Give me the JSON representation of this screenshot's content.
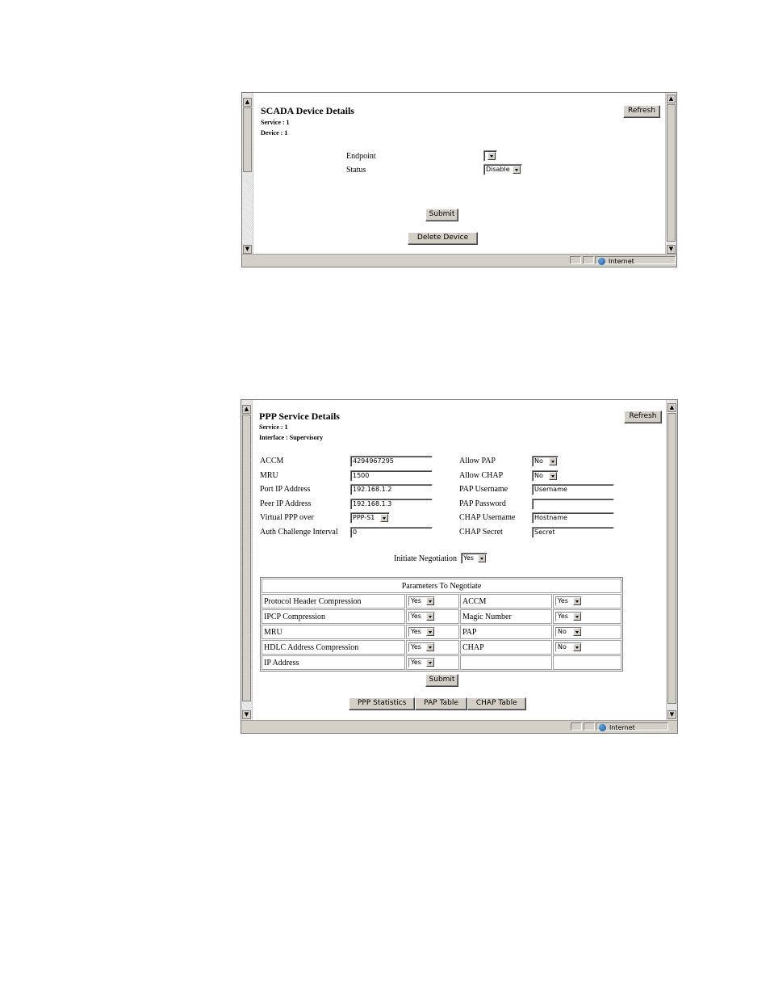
{
  "scada": {
    "title": "SCADA Device Details",
    "service": "Service : 1",
    "device": "Device : 1",
    "refresh_label": "Refresh",
    "endpoint_label": "Endpoint",
    "endpoint_value": "",
    "status_label": "Status",
    "status_value": "Disable",
    "submit_label": "Submit",
    "delete_label": "Delete Device",
    "zone_label": "Internet"
  },
  "ppp": {
    "title": "PPP Service Details",
    "service": "Service : 1",
    "interface": "Interface : Supervisory",
    "refresh_label": "Refresh",
    "fields_left": [
      {
        "label": "ACCM",
        "value": "4294967295",
        "kind": "text"
      },
      {
        "label": "MRU",
        "value": "1500",
        "kind": "text"
      },
      {
        "label": "Port IP Address",
        "value": "192.168.1.2",
        "kind": "text"
      },
      {
        "label": "Peer IP Address",
        "value": "192.168.1.3",
        "kind": "text"
      },
      {
        "label": "Virtual PPP over",
        "value": "PPP-S1",
        "kind": "select"
      },
      {
        "label": "Auth Challenge Interval",
        "value": "0",
        "kind": "text"
      }
    ],
    "fields_right": [
      {
        "label": "Allow PAP",
        "value": "No",
        "kind": "select"
      },
      {
        "label": "Allow CHAP",
        "value": "No",
        "kind": "select"
      },
      {
        "label": "PAP Username",
        "value": "Username",
        "kind": "text"
      },
      {
        "label": "PAP Password",
        "value": "",
        "kind": "text"
      },
      {
        "label": "CHAP Username",
        "value": "Hostname",
        "kind": "text"
      },
      {
        "label": "CHAP Secret",
        "value": "Secret",
        "kind": "text"
      }
    ],
    "initiate_label": "Initiate Negotiation",
    "initiate_value": "Yes",
    "params_header": "Parameters To Negotiate",
    "params_rows": [
      {
        "l_label": "Protocol Header Compression",
        "l_value": "Yes",
        "r_label": "ACCM",
        "r_value": "Yes"
      },
      {
        "l_label": "IPCP Compression",
        "l_value": "Yes",
        "r_label": "Magic Number",
        "r_value": "Yes"
      },
      {
        "l_label": "MRU",
        "l_value": "Yes",
        "r_label": "PAP",
        "r_value": "No"
      },
      {
        "l_label": "HDLC Address Compression",
        "l_value": "Yes",
        "r_label": "CHAP",
        "r_value": "No"
      },
      {
        "l_label": "IP Address",
        "l_value": "Yes",
        "r_label": "",
        "r_value": ""
      }
    ],
    "submit_label": "Submit",
    "bottom_buttons": [
      "PPP Statistics",
      "PAP Table",
      "CHAP Table"
    ],
    "zone_label": "Internet"
  }
}
